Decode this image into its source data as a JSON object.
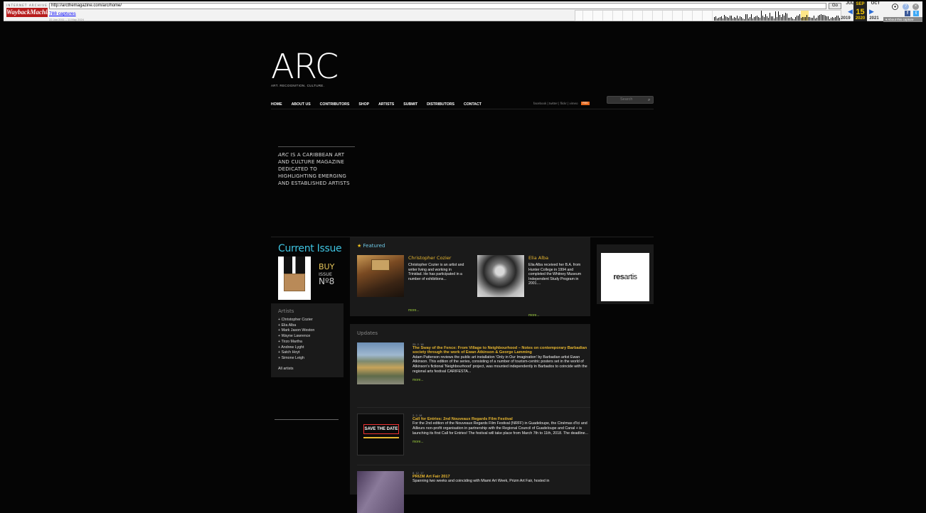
{
  "wayback": {
    "logo_top": "INTERNET ARCHIVE",
    "logo_main": "WaybackMachine",
    "url": "http://arcthemagazine.com/arc/home/",
    "go_label": "Go",
    "captures": "788 captures",
    "date_range": "22 Jan 2011 – 11 May 2024",
    "months": [
      "JUL",
      "SEP",
      "OCT"
    ],
    "day": "15",
    "years": [
      "2019",
      "2020",
      "2021"
    ],
    "about": "About this capture",
    "prev_arrow": "◀",
    "next_arrow": "▶"
  },
  "site": {
    "logo": "ARC",
    "logo_tag": "ART. RECOGNITION. CULTURE.",
    "nav": [
      "HOME",
      "ABOUT US",
      "CONTRIBUTORS",
      "SHOP",
      "ARTISTS",
      "SUBMIT",
      "DISTRIBUTORS",
      "CONTACT"
    ],
    "social": [
      "facebook",
      "twitter",
      "flickr",
      "vimeo"
    ],
    "rss_label": "RSS",
    "search_placeholder": "Search",
    "tagline_em": "ARC",
    "tagline_rest": " IS A CARIBBEAN ART AND CULTURE MAGAZINE DEDICATED TO HIGHLIGHTING EMERGING AND ESTABLISHED ARTISTS"
  },
  "current_issue": {
    "title": "Current Issue",
    "buy": "BUY",
    "issue": "ISSUE",
    "number": "Nº8"
  },
  "artists": {
    "heading": "Artists",
    "items": [
      "+ Christopher Cozier",
      "+ Elia Alba",
      "+ Mark Jason Weston",
      "+ Wayne Lawrence",
      "+ Tirzo Martha",
      "+ Andrew Lyght",
      "+ Satch Hoyt",
      "+ Simone Leigh"
    ],
    "all": "All artists"
  },
  "featured": {
    "title": "Featured",
    "items": [
      {
        "name": "Christopher Cozier",
        "desc": "Christopher Cozier is an artist and writer living and working in Trinidad. He has participated in a number of exhibitions...",
        "more": "more..."
      },
      {
        "name": "Elia Alba",
        "desc": "Elia Alba received her B.A. from Hunter College in 1994 and completed the Whitney Museum Independent Study Program in 2001....",
        "more": "more..."
      }
    ]
  },
  "sponsor": {
    "bold": "res",
    "rest": "artis"
  },
  "updates": {
    "title": "Updates",
    "items": [
      {
        "date": "25. 2. 18",
        "title": "The Sway of the Fence: From Village to Neighbourhood – Notes on contemporary Barbadian society through the work of Ewan Atkinson & George Lamming",
        "text": "Adam Patterson reviews the public art installation 'Only in Our Imagination' by Barbadian artist Ewan Atkinson. This edition of the series, consisting of a number of tourism-centric posters set in the world of Atkinson's fictional 'Neighbourhood' project, was mounted independently in Barbados to coincide with the regional arts festival CARIFESTA...",
        "more": "more..."
      },
      {
        "date": "2. 2. 18",
        "title": "Call for Entries: 2nd Nouveaux Regards Film Festival",
        "text": "For the 2nd edition of the Nouveaux Regards Film Festival (NRFF) in Guadeloupe, the Cinémas d'Ici and Ailleurs non-profit organisation in partnership with the Regional Council of Guadeloupe and Canal + is launching its first Call for Entries! The festival will take place from March 7th to 11th, 2018. The deadline...",
        "more": "more..."
      },
      {
        "date": "8. 12. 17",
        "title": "PRIZM Art Fair 2017",
        "text": "Spanning two weeks and coinciding with Miami Art Week, Prizm Art Fair, hosted in",
        "more": ""
      }
    ],
    "poster_text": "SAVE THE DATE"
  }
}
